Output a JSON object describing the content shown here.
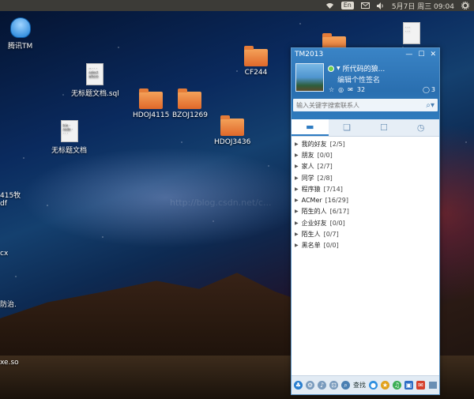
{
  "top_panel": {
    "ime": "En",
    "datetime": "5月7日 周三 09:04",
    "icons": [
      "wifi-icon",
      "volume-icon",
      "settings-icon",
      "mail-icon"
    ]
  },
  "desktop": {
    "icons": {
      "qq": "腾讯TM",
      "sql_file": "无标题文档.sql",
      "txt_file": "无标题文档",
      "hdoj4115": "HDOJ4115",
      "bzoj1269": "BZOJ1269",
      "hdoj3436": "HDOJ3436",
      "cf244": "CF244"
    },
    "left_fragments": [
      "415牧",
      "df",
      "cx",
      "防治.",
      "xe.so"
    ],
    "watermark": "http://blog.csdn.net/c..."
  },
  "tm": {
    "title": "TM2013",
    "nickname": "所代码的狼...",
    "signature": "编辑个性签名",
    "message_count": "3",
    "mail_count": "32",
    "search_placeholder": "输入关键字搜索联系人",
    "groups": [
      {
        "name": "我的好友",
        "count": "[2/5]"
      },
      {
        "name": "朋友",
        "count": "[0/0]"
      },
      {
        "name": "家人",
        "count": "[2/7]"
      },
      {
        "name": "同学",
        "count": "[2/8]"
      },
      {
        "name": "程序猿",
        "count": "[7/14]"
      },
      {
        "name": "ACMer",
        "count": "[16/29]"
      },
      {
        "name": "陌生的人",
        "count": "[6/17]"
      },
      {
        "name": "企业好友",
        "count": "[0/0]"
      },
      {
        "name": "陌生人",
        "count": "[0/7]"
      },
      {
        "name": "黑名单",
        "count": "[0/0]"
      }
    ],
    "bottom_find": "查找"
  }
}
